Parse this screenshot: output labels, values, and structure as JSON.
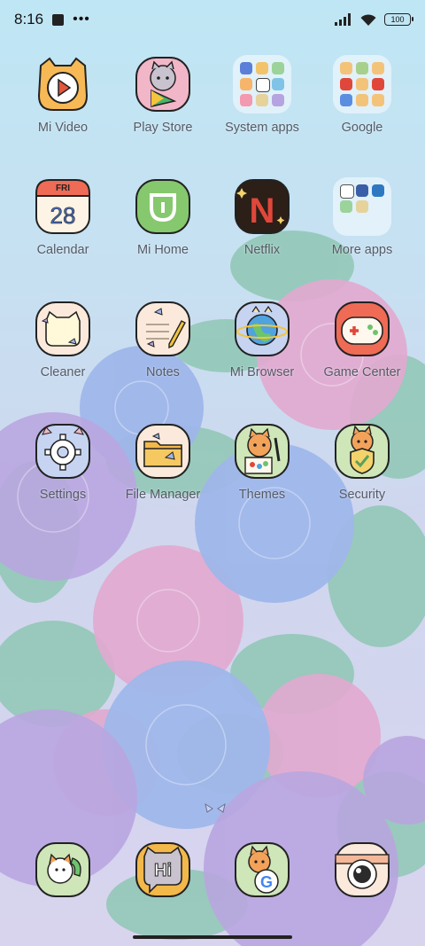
{
  "status_bar": {
    "time": "8:16",
    "notification_icons": [
      "square-icon",
      "more-dots-icon"
    ],
    "signal_icon": "signal-icon",
    "wifi_icon": "wifi-icon",
    "battery_level": "100"
  },
  "apps": [
    {
      "label": "Mi Video",
      "icon": "mi-video-icon"
    },
    {
      "label": "Play Store",
      "icon": "play-store-icon"
    },
    {
      "label": "System apps",
      "icon": "folder-icon"
    },
    {
      "label": "Google",
      "icon": "folder-icon"
    },
    {
      "label": "Calendar",
      "icon": "calendar-icon",
      "day": "FRI",
      "date": "28"
    },
    {
      "label": "Mi Home",
      "icon": "mi-home-icon"
    },
    {
      "label": "Netflix",
      "icon": "netflix-icon",
      "letter": "N"
    },
    {
      "label": "More apps",
      "icon": "folder-icon"
    },
    {
      "label": "Cleaner",
      "icon": "cleaner-icon"
    },
    {
      "label": "Notes",
      "icon": "notes-icon"
    },
    {
      "label": "Mi Browser",
      "icon": "browser-icon"
    },
    {
      "label": "Game Center",
      "icon": "game-center-icon"
    },
    {
      "label": "Settings",
      "icon": "settings-icon"
    },
    {
      "label": "File Manager",
      "icon": "file-manager-icon"
    },
    {
      "label": "Themes",
      "icon": "themes-icon"
    },
    {
      "label": "Security",
      "icon": "security-icon"
    }
  ],
  "dock": [
    {
      "icon": "phone-icon"
    },
    {
      "icon": "messages-icon",
      "text": "Hi"
    },
    {
      "icon": "chrome-icon",
      "text": "G"
    },
    {
      "icon": "camera-icon"
    }
  ],
  "colors": {
    "sky_top": "#bfe6f4",
    "hydrangea_purple": "#b9a6e0",
    "hydrangea_blue": "#9fb7ea",
    "hydrangea_pink": "#e2a9cf",
    "leaf_green": "#8fc7b4",
    "label_gray": "#555a66",
    "netflix_red": "#e0473a"
  }
}
